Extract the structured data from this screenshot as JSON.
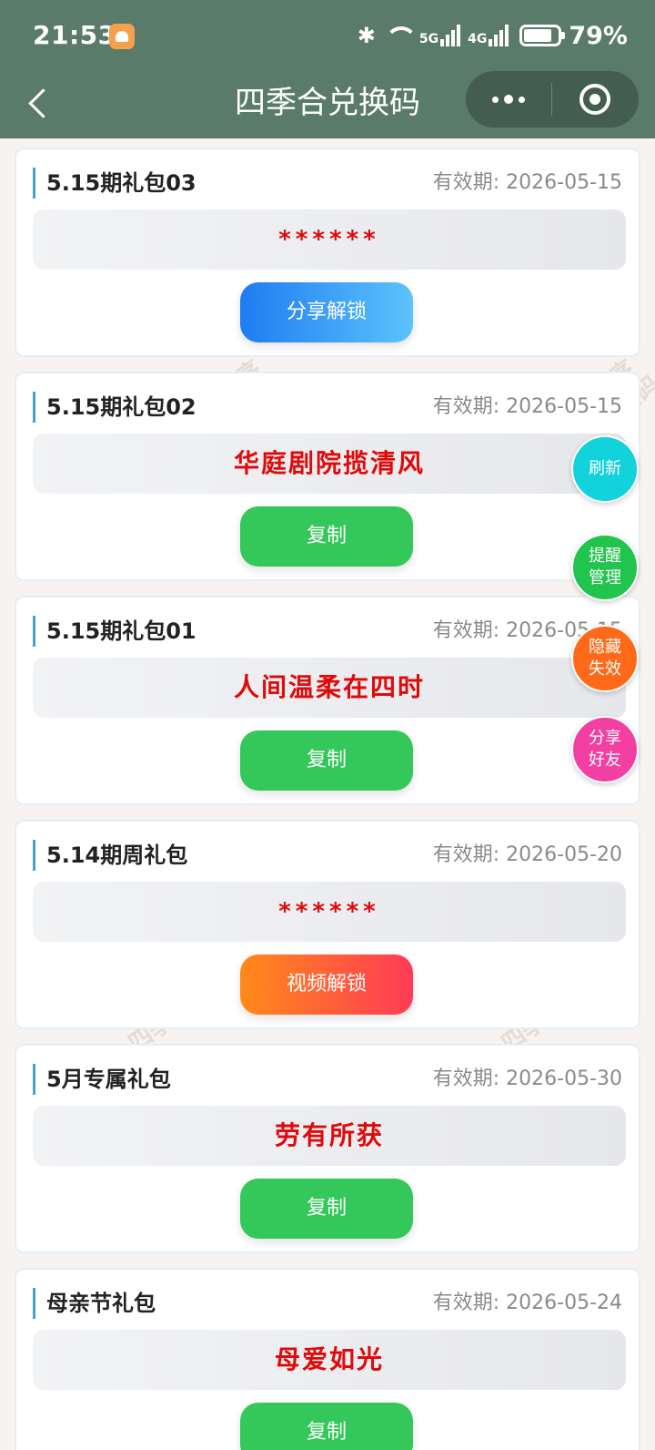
{
  "status_bar": {
    "time": "21:53",
    "bluetooth": "✱",
    "net1": "5G",
    "net2": "4G",
    "battery_pct": "79%"
  },
  "nav": {
    "title": "四季合兑换码"
  },
  "cards": [
    {
      "title": "5.15期礼包03",
      "expiry": "有效期: 2026-05-15",
      "code": "******",
      "button": "分享解锁"
    },
    {
      "title": "5.15期礼包02",
      "expiry": "有效期: 2026-05-15",
      "code": "华庭剧院揽清风",
      "button": "复制"
    },
    {
      "title": "5.15期礼包01",
      "expiry": "有效期: 2026-05-15",
      "code": "人间温柔在四时",
      "button": "复制"
    },
    {
      "title": "5.14期周礼包",
      "expiry": "有效期: 2026-05-20",
      "code": "******",
      "button": "视频解锁"
    },
    {
      "title": "5月专属礼包",
      "expiry": "有效期: 2026-05-30",
      "code": "劳有所获",
      "button": "复制"
    },
    {
      "title": "母亲节礼包",
      "expiry": "有效期: 2026-05-24",
      "code": "母爱如光",
      "button": "复制"
    }
  ],
  "watermark": {
    "line1": "微信小程序",
    "line2": "四季合兑换码"
  },
  "floating": {
    "refresh": "刷新",
    "remind": "提醒管理",
    "hide": "隐藏失效",
    "share": "分享好友"
  },
  "colors": {
    "header_bg": "#5a7b6a",
    "code_text": "#e00a0a",
    "copy_button": "#34c759"
  }
}
